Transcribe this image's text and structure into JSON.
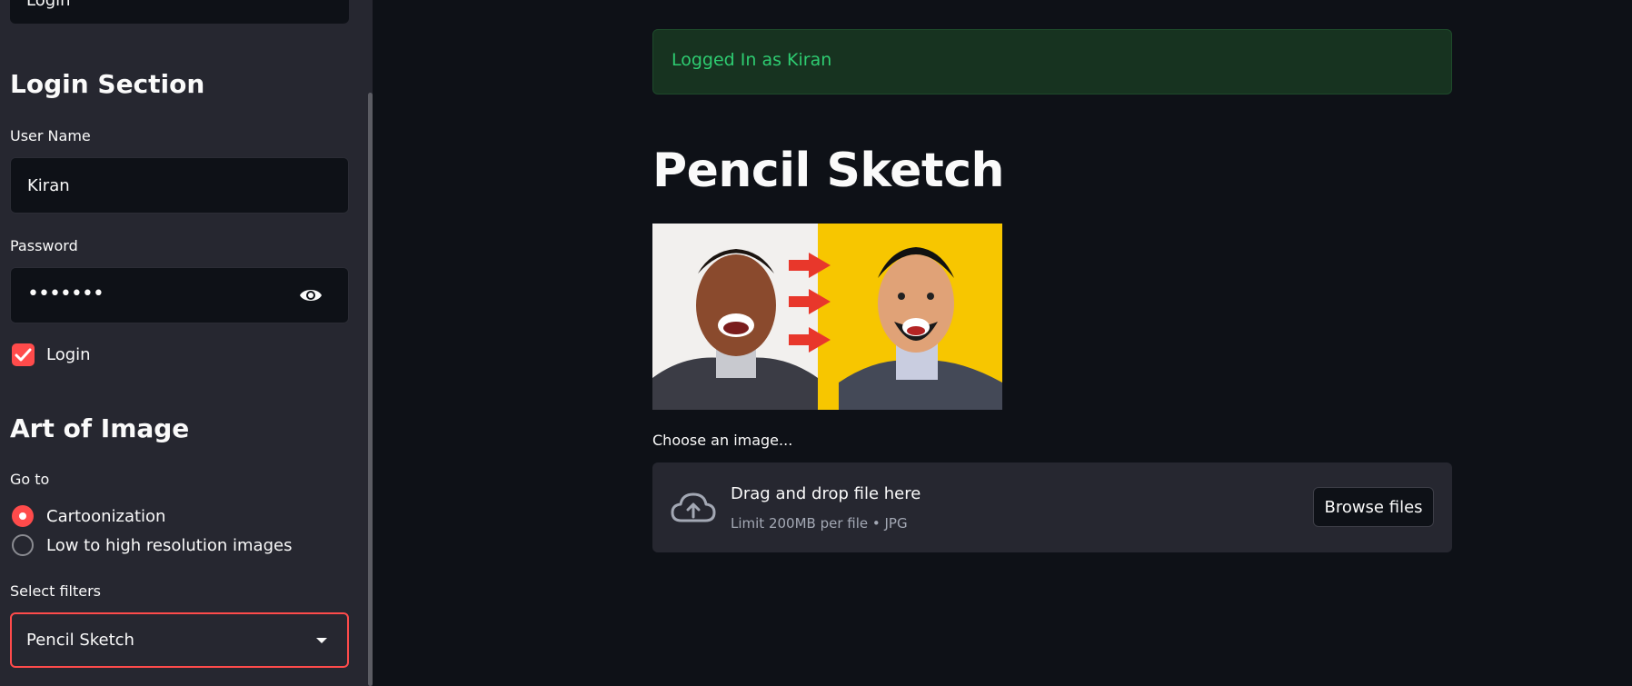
{
  "sidebar": {
    "top_button_label": "Login",
    "login_section": {
      "heading": "Login Section",
      "username_label": "User Name",
      "username_value": "Kiran",
      "password_label": "Password",
      "password_value": "•••••••",
      "login_checkbox_label": "Login",
      "login_checked": true
    },
    "art_section": {
      "heading": "Art of Image",
      "goto_label": "Go to",
      "options": [
        {
          "label": "Cartoonization",
          "selected": true
        },
        {
          "label": "Low to high resolution images",
          "selected": false
        }
      ],
      "filters_label": "Select filters",
      "filters_value": "Pencil Sketch"
    }
  },
  "main": {
    "alert_text": "Logged In as Kiran",
    "title": "Pencil Sketch",
    "file_label": "Choose an image...",
    "dropzone": {
      "title": "Drag and drop file here",
      "subtitle": "Limit 200MB per file • JPG",
      "browse_label": "Browse files"
    }
  },
  "colors": {
    "accent": "#ff4b4b",
    "background": "#0e1117",
    "sidebar": "#262730",
    "success_text": "#2ecc71"
  },
  "icons": {
    "eye": "eye-icon",
    "cloud": "cloud-upload-icon",
    "check": "check-icon",
    "caret": "chevron-down-icon"
  }
}
